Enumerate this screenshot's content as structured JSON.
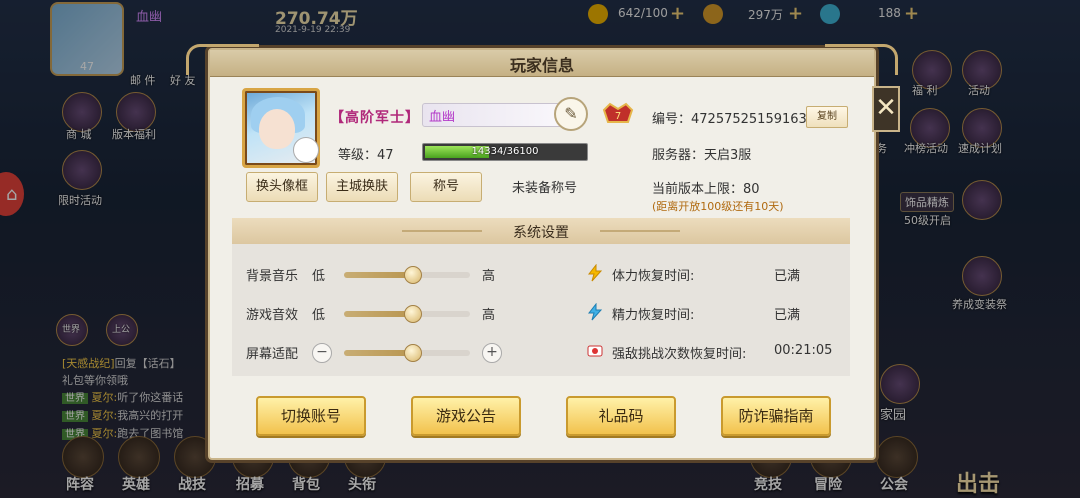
{
  "hud": {
    "player_name": "血幽",
    "avatar_level": "47",
    "power": "270.74万",
    "datetime": "2021-9-19 22:39",
    "stamina": "642/100",
    "gold": "297万",
    "gems": "188",
    "mail": "邮 件",
    "friends": "好 友",
    "shop": "商 城",
    "version_welfare": "版本福利",
    "limited_event": "限时活动",
    "welfare": "福 利",
    "events": "活动",
    "rank_event": "冲榜活动",
    "speed_plan": "速成计划",
    "task": "务",
    "ornament": "饰品精炼",
    "ornament_unlock": "50级开启",
    "dress_up": "养成变装祭",
    "home": "家园",
    "world": "世界",
    "elder": "上公",
    "bottom_nav": [
      "阵容",
      "英雄",
      "战技",
      "招募",
      "背包",
      "头衔",
      "竞技",
      "冒险",
      "公会"
    ],
    "exit": "出击",
    "chat": [
      {
        "speaker": "[天感战纪]",
        "text": "回复【话石】"
      },
      {
        "speaker": "",
        "text": "礼包等你领哦"
      },
      {
        "tag": "世界",
        "speaker": "夏尔:",
        "text": "听了你这番话"
      },
      {
        "tag": "世界",
        "speaker": "夏尔:",
        "text": "我高兴的打开"
      },
      {
        "tag": "世界",
        "speaker": "夏尔:",
        "text": "跑去了图书馆"
      }
    ]
  },
  "dialog": {
    "title": "玩家信息",
    "rank": "【高阶军士】",
    "name": "血幽",
    "vip_level": "7",
    "level_label": "等级：",
    "level": "47",
    "exp_text": "14334/36100",
    "exp_fraction": 0.397,
    "btn_change_frame": "换头像框",
    "btn_change_skin": "主城换肤",
    "btn_title": "称号",
    "no_title": "未装备称号",
    "id_label": "编号：",
    "id_value": "47257525159163",
    "copy": "复制",
    "server_label": "服务器：",
    "server_value": "天启3服",
    "cap_label": "当前版本上限：",
    "cap_value": "80",
    "cap_note": "(距离开放100级还有10天)",
    "close": "✕"
  },
  "settings": {
    "title": "系统设置",
    "bgm_label": "背景音乐",
    "sfx_label": "游戏音效",
    "screen_label": "屏幕适配",
    "low": "低",
    "high": "高",
    "bgm_level": 0.54,
    "sfx_level": 0.54,
    "screen_level": 0.54,
    "stamina_recover_label": "体力恢复时间:",
    "stamina_recover_value": "已满",
    "energy_recover_label": "精力恢复时间:",
    "energy_recover_value": "已满",
    "challenge_label": "强敌挑战次数恢复时间:",
    "challenge_value": "00:21:05"
  },
  "actions": {
    "switch_account": "切换账号",
    "announcement": "游戏公告",
    "gift_code": "礼品码",
    "anti_fraud": "防诈骗指南"
  },
  "colors": {
    "accent_gold": "#f2c24d",
    "exp_green": "#49a21f",
    "name_purple": "#b43cc9",
    "rank_magenta": "#b0287a",
    "note_orange": "#b06a10"
  }
}
